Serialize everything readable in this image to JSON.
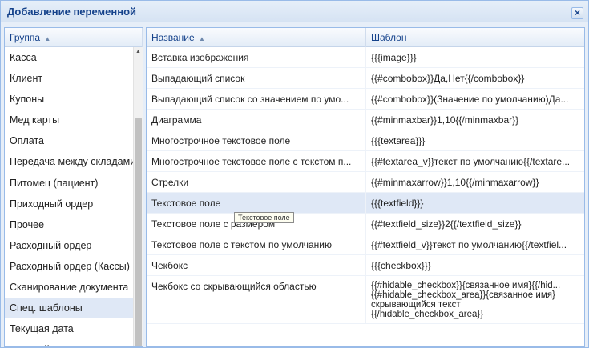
{
  "window": {
    "title": "Добавление переменной",
    "close_icon": "close-icon"
  },
  "left": {
    "header": "Группа",
    "groups": [
      "Касса",
      "Клиент",
      "Купоны",
      "Мед карты",
      "Оплата",
      "Передача между складами",
      "Питомец (пациент)",
      "Приходный ордер",
      "Прочее",
      "Расходный ордер",
      "Расходный ордер (Кассы)",
      "Сканирование документа",
      "Спец. шаблоны",
      "Текущая дата",
      "Текущий пользователь"
    ],
    "selected_index": 12
  },
  "right": {
    "header_name": "Название",
    "header_template": "Шаблон",
    "rows": [
      {
        "name": "Вставка изображения",
        "tpl": "{{{image}}}"
      },
      {
        "name": "Выпадающий список",
        "tpl": "{{#combobox}}Да,Нет{{/combobox}}"
      },
      {
        "name": "Выпадающий список со значением по умо...",
        "tpl": "{{#combobox}}(Значение по умолчанию)Да..."
      },
      {
        "name": "Диаграмма",
        "tpl": "{{#minmaxbar}}1,10{{/minmaxbar}}"
      },
      {
        "name": "Многострочное текстовое поле",
        "tpl": "{{{textarea}}}"
      },
      {
        "name": "Многострочное текстовое поле с текстом п...",
        "tpl": "{{#textarea_v}}текст по умолчанию{{/textare..."
      },
      {
        "name": "Стрелки",
        "tpl": "{{#minmaxarrow}}1,10{{/minmaxarrow}}"
      },
      {
        "name": "Текстовое поле",
        "tpl": "{{{textfield}}}"
      },
      {
        "name": "Текстовое поле с размером",
        "tpl": "{{#textfield_size}}2{{/textfield_size}}"
      },
      {
        "name": "Текстовое поле с текстом по умолчанию",
        "tpl": "{{#textfield_v}}текст по умолчанию{{/textfiel..."
      },
      {
        "name": "Чекбокс",
        "tpl": "{{{checkbox}}}"
      }
    ],
    "last_row": {
      "name": "Чекбокс со скрывающийся областью",
      "tpl_lines": [
        "{{#hidable_checkbox}}{связанное имя}{{/hid...",
        "{{#hidable_checkbox_area}}{связанное имя}",
        "скрывающийся текст",
        "{{/hidable_checkbox_area}}"
      ]
    },
    "selected_index": 7,
    "tooltip": "Текстовое поле"
  }
}
